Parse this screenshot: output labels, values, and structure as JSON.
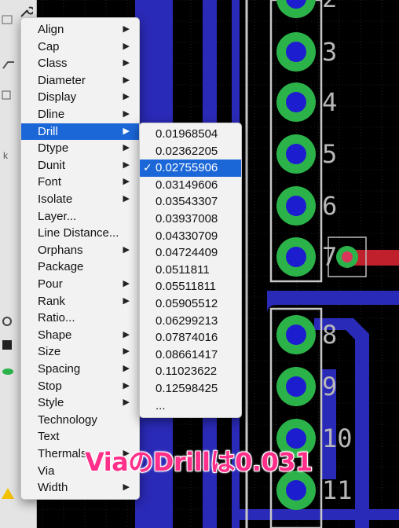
{
  "context_menu": {
    "items": [
      {
        "label": "Align",
        "submenu": true
      },
      {
        "label": "Cap",
        "submenu": true
      },
      {
        "label": "Class",
        "submenu": true
      },
      {
        "label": "Diameter",
        "submenu": true
      },
      {
        "label": "Display",
        "submenu": true
      },
      {
        "label": "Dline",
        "submenu": true
      },
      {
        "label": "Drill",
        "submenu": true,
        "selected": true
      },
      {
        "label": "Dtype",
        "submenu": true
      },
      {
        "label": "Dunit",
        "submenu": true
      },
      {
        "label": "Font",
        "submenu": true
      },
      {
        "label": "Isolate",
        "submenu": true
      },
      {
        "label": "Layer...",
        "submenu": false
      },
      {
        "label": "Line Distance...",
        "submenu": false
      },
      {
        "label": "Orphans",
        "submenu": true
      },
      {
        "label": "Package",
        "submenu": false
      },
      {
        "label": "Pour",
        "submenu": true
      },
      {
        "label": "Rank",
        "submenu": true
      },
      {
        "label": "Ratio...",
        "submenu": false
      },
      {
        "label": "Shape",
        "submenu": true
      },
      {
        "label": "Size",
        "submenu": true
      },
      {
        "label": "Spacing",
        "submenu": true
      },
      {
        "label": "Stop",
        "submenu": true
      },
      {
        "label": "Style",
        "submenu": true
      },
      {
        "label": "Technology",
        "submenu": false
      },
      {
        "label": "Text",
        "submenu": false
      },
      {
        "label": "Thermals",
        "submenu": true
      },
      {
        "label": "Via",
        "submenu": false
      },
      {
        "label": "Width",
        "submenu": true
      }
    ]
  },
  "drill_submenu": {
    "checkmark": "✓",
    "items": [
      "0.01968504",
      "0.02362205",
      "0.02755906",
      "0.03149606",
      "0.03543307",
      "0.03937008",
      "0.04330709",
      "0.04724409",
      "0.0511811",
      "0.05511811",
      "0.05905512",
      "0.06299213",
      "0.07874016",
      "0.08661417",
      "0.11023622",
      "0.12598425",
      "..."
    ],
    "checked_index": 2
  },
  "pcb": {
    "pad_labels": [
      "2",
      "3",
      "4",
      "5",
      "6",
      "7",
      "8",
      "9",
      "10",
      "11"
    ],
    "colors": {
      "background": "#000000",
      "trace": "#2a2ab8",
      "pad": "#2bb34a",
      "pad_hole": "#1d1dd0",
      "via": "#d9365a",
      "outline": "#c8c8c8",
      "grid": "#3a3a3a"
    }
  },
  "caption": {
    "text": "ViaのDrillは0.031",
    "color": "#ff2f8a"
  },
  "toolbar_icons": [
    "wrench-icon",
    "layer-icon",
    "route-icon",
    "via-icon",
    "text-icon",
    "circle-icon",
    "polygon-icon",
    "ratsnest-icon",
    "signal-icon"
  ]
}
